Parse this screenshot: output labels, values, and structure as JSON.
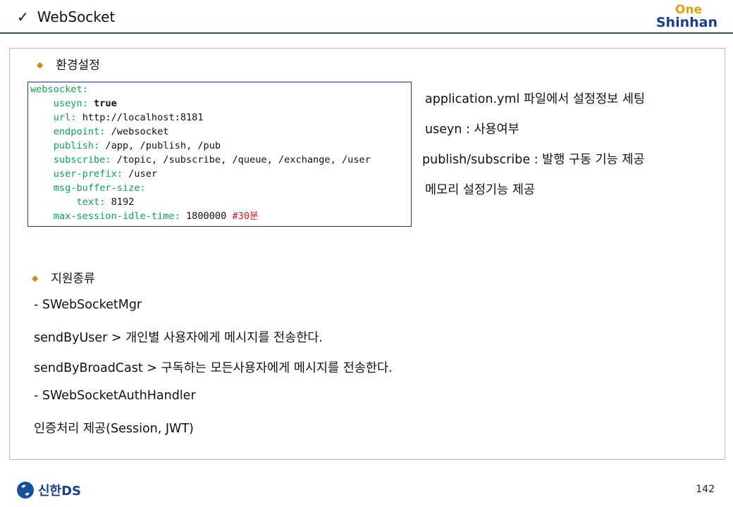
{
  "header": {
    "check_icon": "✓",
    "title": "WebSocket",
    "logo_top": "One",
    "logo_bottom": "Shinhan"
  },
  "section1": {
    "bullet": "환경설정",
    "code": {
      "root": "websocket:",
      "lines": [
        {
          "key": "useyn:",
          "value": "true"
        },
        {
          "key": "url:",
          "value": "http://localhost:8181"
        },
        {
          "key": "endpoint:",
          "value": "/websocket"
        },
        {
          "key": "publish:",
          "value": "/app, /publish, /pub"
        },
        {
          "key": "subscribe:",
          "value": "/topic, /subscribe, /queue, /exchange, /user"
        },
        {
          "key": "user-prefix:",
          "value": "/user"
        },
        {
          "key": "msg-buffer-size:",
          "value": ""
        },
        {
          "key": "text:",
          "value": "8192"
        },
        {
          "key": "max-session-idle-time:",
          "value": "1800000",
          "comment": "#30분"
        }
      ]
    },
    "descriptions": [
      "application.yml 파일에서 설정정보 세팅",
      "useyn : 사용여부",
      "publish/subscribe : 발행 구동 기능 제공",
      "메모리 설정기능 제공"
    ]
  },
  "section2": {
    "bullet": "지원종류",
    "lines": [
      "- SWebSocketMgr",
      "sendByUser > 개인별 사용자에게 메시지를 전송한다.",
      "sendByBroadCast > 구독하는 모든사용자에게 메시지를 전송한다.",
      "- SWebSocketAuthHandler",
      "인증처리 제공(Session, JWT)"
    ]
  },
  "footer": {
    "brand": "신한DS",
    "page_number": "142"
  }
}
